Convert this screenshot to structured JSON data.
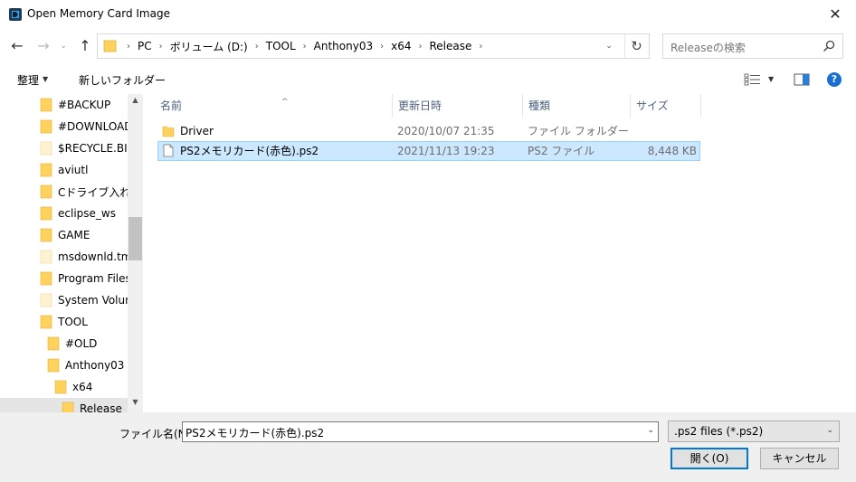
{
  "window": {
    "title": "Open Memory Card Image",
    "close_glyph": "✕"
  },
  "nav": {
    "back_glyph": "←",
    "forward_glyph": "→",
    "recent_glyph": "⌄",
    "up_glyph": "↑"
  },
  "address": {
    "crumbs": [
      "PC",
      "ボリューム (D:)",
      "TOOL",
      "Anthony03",
      "x64",
      "Release"
    ],
    "separator": "›",
    "dropdown_glyph": "⌄",
    "refresh_glyph": "↻"
  },
  "search": {
    "placeholder": "Releaseの検索"
  },
  "toolbar": {
    "organize_label": "整理",
    "new_folder_label": "新しいフォルダー",
    "caret_glyph": "▼",
    "help_glyph": "?"
  },
  "sidebar": {
    "items": [
      {
        "label": "#BACKUP"
      },
      {
        "label": "#DOWNLOAD"
      },
      {
        "label": "$RECYCLE.BIN"
      },
      {
        "label": "aviutl"
      },
      {
        "label": "Cドライブ入れ替え"
      },
      {
        "label": "eclipse_ws"
      },
      {
        "label": "GAME"
      },
      {
        "label": "msdownld.tmp"
      },
      {
        "label": "Program Files"
      },
      {
        "label": "System Volume"
      },
      {
        "label": "TOOL"
      },
      {
        "label": "#OLD"
      },
      {
        "label": "Anthony03"
      },
      {
        "label": "x64"
      },
      {
        "label": "Release"
      }
    ],
    "scroll_up_glyph": "▲",
    "scroll_down_glyph": "▼"
  },
  "filelist": {
    "columns": [
      "名前",
      "更新日時",
      "種類",
      "サイズ"
    ],
    "sort_glyph": "^",
    "rows": [
      {
        "name": "Driver",
        "date": "2020/10/07 21:35",
        "type": "ファイル フォルダー",
        "size": "",
        "kind": "folder"
      },
      {
        "name": "PS2メモリカード(赤色).ps2",
        "date": "2021/11/13 19:23",
        "type": "PS2 ファイル",
        "size": "8,448 KB",
        "kind": "file"
      }
    ]
  },
  "footer": {
    "filename_label": "ファイル名(N):",
    "filename_value": "PS2メモリカード(赤色).ps2",
    "filetype_value": ".ps2 files (*.ps2)",
    "open_label": "開く(O)",
    "cancel_label": "キャンセル",
    "caret_glyph": "⌄"
  },
  "colors": {
    "folder": "#ffd35b",
    "selection_bg": "#cce8ff",
    "selection_border": "#99d1ff",
    "header_text": "#4d6182",
    "accent": "#0078d7"
  }
}
